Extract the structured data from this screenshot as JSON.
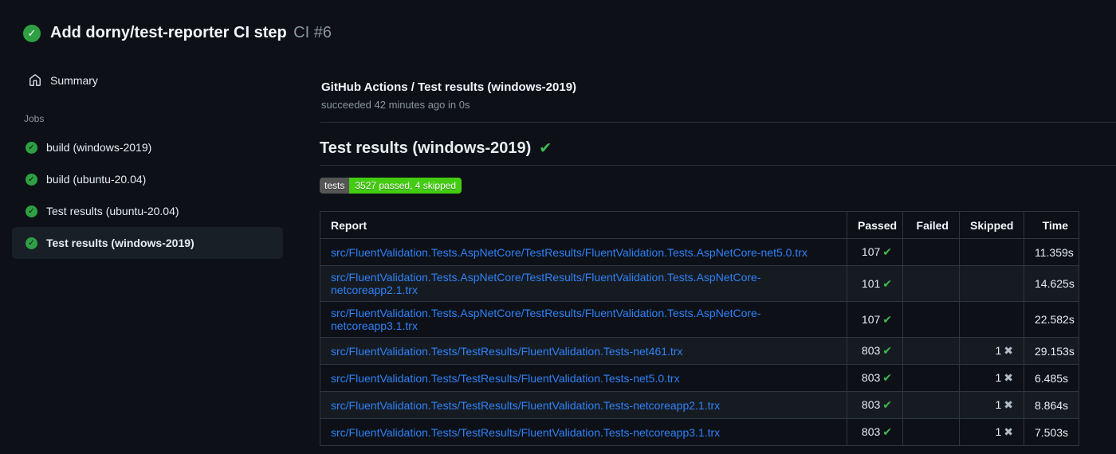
{
  "colors": {
    "page_background": "#0d1117",
    "accent_green": "#2ea043",
    "bright_green": "#3fb950",
    "badge_green": "#44cc11",
    "badge_gray": "#555555",
    "link_blue": "#2f81f7"
  },
  "header": {
    "title": "Add dorny/test-reporter CI step",
    "run_number": "CI #6"
  },
  "sidebar": {
    "summary_label": "Summary",
    "jobs_label": "Jobs",
    "jobs": [
      {
        "label": "build (windows-2019)",
        "status": "success",
        "selected": false
      },
      {
        "label": "build (ubuntu-20.04)",
        "status": "success",
        "selected": false
      },
      {
        "label": "Test results (ubuntu-20.04)",
        "status": "success",
        "selected": false
      },
      {
        "label": "Test results (windows-2019)",
        "status": "success",
        "selected": true
      }
    ]
  },
  "main": {
    "job_title": "GitHub Actions / Test results (windows-2019)",
    "job_status": "succeeded 42 minutes ago in 0s",
    "heading": "Test results (windows-2019)",
    "badge": {
      "label": "tests",
      "value": "3527 passed, 4 skipped"
    },
    "table": {
      "headers": [
        "Report",
        "Passed",
        "Failed",
        "Skipped",
        "Time"
      ],
      "rows": [
        {
          "report": "src/FluentValidation.Tests.AspNetCore/TestResults/FluentValidation.Tests.AspNetCore-net5.0.trx",
          "passed": "107",
          "failed": "",
          "skipped": "",
          "time": "11.359s"
        },
        {
          "report": "src/FluentValidation.Tests.AspNetCore/TestResults/FluentValidation.Tests.AspNetCore-netcoreapp2.1.trx",
          "passed": "101",
          "failed": "",
          "skipped": "",
          "time": "14.625s"
        },
        {
          "report": "src/FluentValidation.Tests.AspNetCore/TestResults/FluentValidation.Tests.AspNetCore-netcoreapp3.1.trx",
          "passed": "107",
          "failed": "",
          "skipped": "",
          "time": "22.582s"
        },
        {
          "report": "src/FluentValidation.Tests/TestResults/FluentValidation.Tests-net461.trx",
          "passed": "803",
          "failed": "",
          "skipped": "1",
          "time": "29.153s"
        },
        {
          "report": "src/FluentValidation.Tests/TestResults/FluentValidation.Tests-net5.0.trx",
          "passed": "803",
          "failed": "",
          "skipped": "1",
          "time": "6.485s"
        },
        {
          "report": "src/FluentValidation.Tests/TestResults/FluentValidation.Tests-netcoreapp2.1.trx",
          "passed": "803",
          "failed": "",
          "skipped": "1",
          "time": "8.864s"
        },
        {
          "report": "src/FluentValidation.Tests/TestResults/FluentValidation.Tests-netcoreapp3.1.trx",
          "passed": "803",
          "failed": "",
          "skipped": "1",
          "time": "7.503s"
        }
      ]
    }
  }
}
